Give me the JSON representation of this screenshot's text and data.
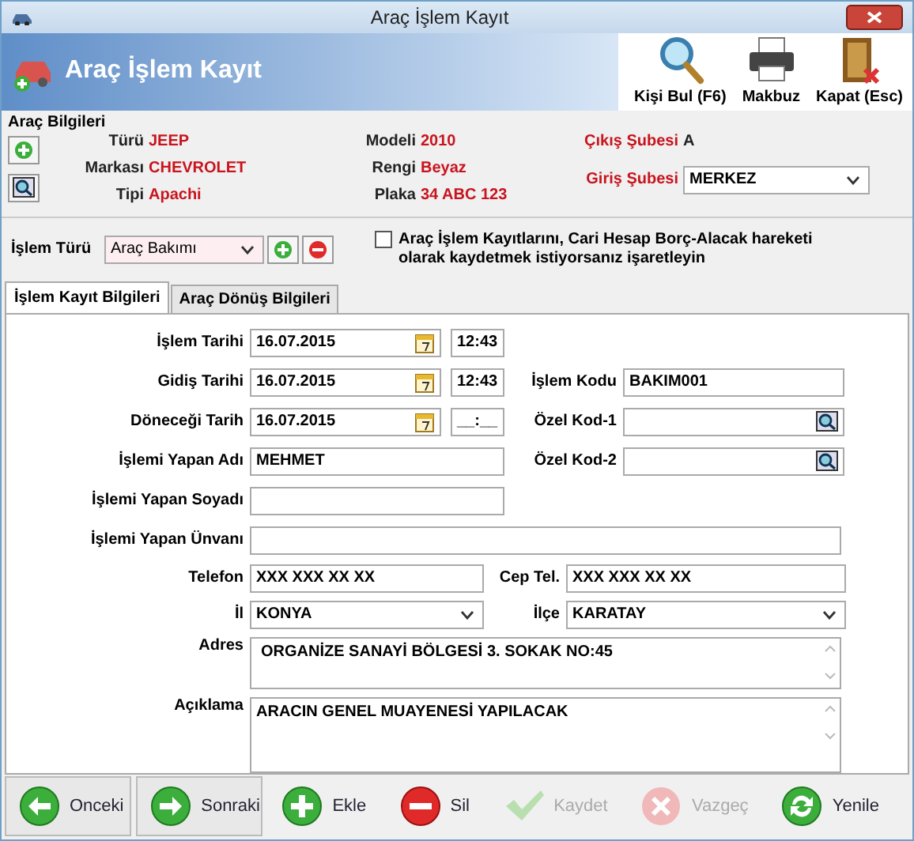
{
  "window": {
    "title": "Araç İşlem Kayıt"
  },
  "header": {
    "title": "Araç İşlem Kayıt",
    "tools": [
      {
        "label": "Kişi Bul (F6)",
        "kind": "search"
      },
      {
        "label": "Makbuz",
        "kind": "printer"
      },
      {
        "label": "Kapat (Esc)",
        "kind": "door"
      }
    ]
  },
  "vehicle_info": {
    "title": "Araç Bilgileri",
    "columns": [
      [
        {
          "label": "Türü",
          "value": "JEEP"
        },
        {
          "label": "Markası",
          "value": "CHEVROLET"
        },
        {
          "label": "Tipi",
          "value": "Apachi"
        }
      ],
      [
        {
          "label": "Modeli",
          "value": "2010"
        },
        {
          "label": "Rengi",
          "value": "Beyaz"
        },
        {
          "label": "Plaka",
          "value": "34 ABC 123"
        }
      ]
    ],
    "exit_branch": {
      "label": "Çıkış Şubesi",
      "value": "A"
    },
    "entry_branch": {
      "label": "Giriş Şubesi",
      "value": "MERKEZ"
    }
  },
  "operation_type": {
    "label": "İşlem Türü",
    "value": "Araç Bakımı"
  },
  "account_option": {
    "label": "Araç İşlem Kayıtlarını, Cari Hesap Borç-Alacak hareketi olarak kaydetmek istiyorsanız işaretleyin",
    "checked": false
  },
  "tabs": [
    {
      "label": "İşlem Kayıt Bilgileri",
      "selected": true
    },
    {
      "label": "Araç Dönüş Bilgileri",
      "selected": false
    }
  ],
  "form": {
    "rows": [
      {
        "label": "İşlem Tarihi",
        "date": "16.07.2015",
        "time": "12:43"
      },
      {
        "label": "Gidiş Tarihi",
        "date": "16.07.2015",
        "time": "12:43",
        "right": {
          "label": "İşlem Kodu",
          "value": "BAKIM001",
          "kind": "text"
        }
      },
      {
        "label": "Döneceği Tarih",
        "date": "16.07.2015",
        "time": "__:__",
        "right": {
          "label": "Özel Kod-1",
          "kind": "lookup"
        }
      },
      {
        "label": "İşlemi Yapan Adı",
        "value": "MEHMET",
        "right": {
          "label": "Özel Kod-2",
          "kind": "lookup"
        }
      },
      {
        "label": "İşlemi Yapan Soyadı"
      }
    ],
    "title_field": {
      "label": "İşlemi Yapan Ünvanı"
    },
    "pairs": [
      {
        "kind": "text",
        "left": {
          "label": "Telefon",
          "value": "XXX XXX XX XX"
        },
        "right": {
          "label": "Cep Tel.",
          "value": "XXX XXX XX XX"
        }
      },
      {
        "kind": "select",
        "left": {
          "label": "İl",
          "value": "KONYA"
        },
        "right": {
          "label": "İlçe",
          "value": "KARATAY"
        }
      }
    ],
    "address": {
      "label": "Adres",
      "value": "ORGANİZE SANAYİ BÖLGESİ 3. SOKAK NO:45"
    },
    "description": {
      "label": "Açıklama",
      "value": "ARACIN GENEL MUAYENESİ YAPILACAK"
    }
  },
  "buttons": [
    {
      "label": "Onceki",
      "kind": "back",
      "disabled": false
    },
    {
      "label": "Sonraki",
      "kind": "forward",
      "disabled": false
    },
    {
      "label": "Ekle",
      "kind": "add",
      "disabled": false
    },
    {
      "label": "Sil",
      "kind": "remove",
      "disabled": false
    },
    {
      "label": "Kaydet",
      "kind": "check",
      "disabled": true
    },
    {
      "label": "Vazgeç",
      "kind": "cancel",
      "disabled": true
    },
    {
      "label": "Yenile",
      "kind": "refresh",
      "disabled": false
    }
  ]
}
